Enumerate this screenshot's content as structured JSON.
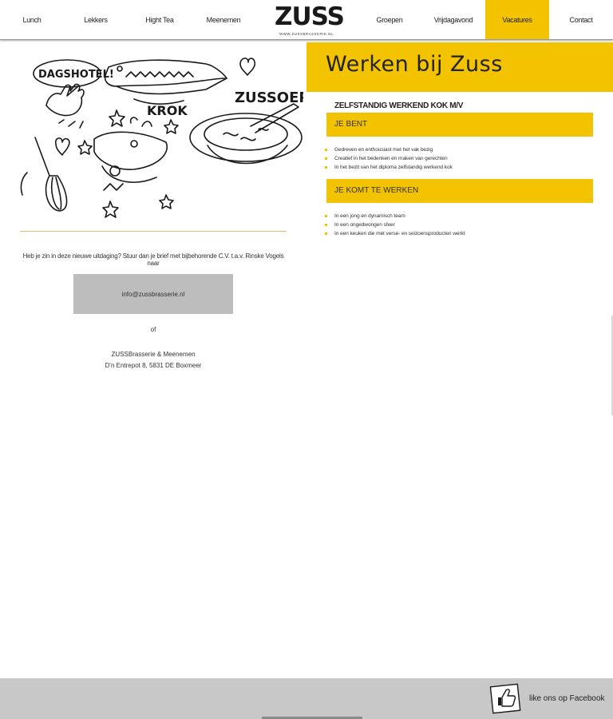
{
  "nav": {
    "left_items": [
      {
        "label": "Lunch"
      },
      {
        "label": "Lekkers"
      },
      {
        "label": "Hight Tea"
      },
      {
        "label": "Meenemen"
      }
    ],
    "right_items": [
      {
        "label": "Groepen"
      },
      {
        "label": "Vrijdagavond"
      },
      {
        "label": "Vacatures",
        "active": true
      },
      {
        "label": "Contact"
      }
    ]
  },
  "logo": {
    "text": "ZUSS",
    "url": "WWW.ZUSSBRASSERIE.NL"
  },
  "illustration": {
    "labels": [
      "DAGSHOTEL!",
      "KROK",
      "ZUSSOEP"
    ]
  },
  "apply": {
    "text": "Heb je zin in deze nieuwe uitdaging? Stuur dan je brief met bijbehorende C.V. t.a.v. Rinske Vogels naar",
    "email": "info@zussbrasserie.nl",
    "or": "of",
    "address_line1": "ZUSSBrasserie & Meenemen",
    "address_line2": "D'n Entrepot 8, 5831 DE Boxmeer"
  },
  "hero": {
    "title": "Werken bij Zuss"
  },
  "job": {
    "title": "ZELFSTANDIG WERKEND KOK M/V",
    "sections": [
      {
        "heading": "JE BENT",
        "items": [
          "Gedreven en enthousiast met het vak bezig",
          "Creatief in het bedenken en maken van gerechten",
          "In het bezit van het diploma zelfstandig werkend kok"
        ]
      },
      {
        "heading": "JE KOMT TE WERKEN",
        "items": [
          "In een jong en dynamisch team",
          "In een ongedwongen sfeer",
          "In een keuken die met verse- en seizoensproducten werkt"
        ]
      }
    ]
  },
  "footer": {
    "facebook_label": "like ons op Facebook"
  },
  "colors": {
    "accent": "#f3c300",
    "button_gray": "#bdbdbd",
    "footer_gray": "#c8c8c8"
  },
  "icons": [
    "thumbs-up-icon",
    "heart-icon",
    "star-icon",
    "whisk-icon",
    "crocodile-icon",
    "soup-bowl-icon",
    "waving-hand-icon"
  ]
}
